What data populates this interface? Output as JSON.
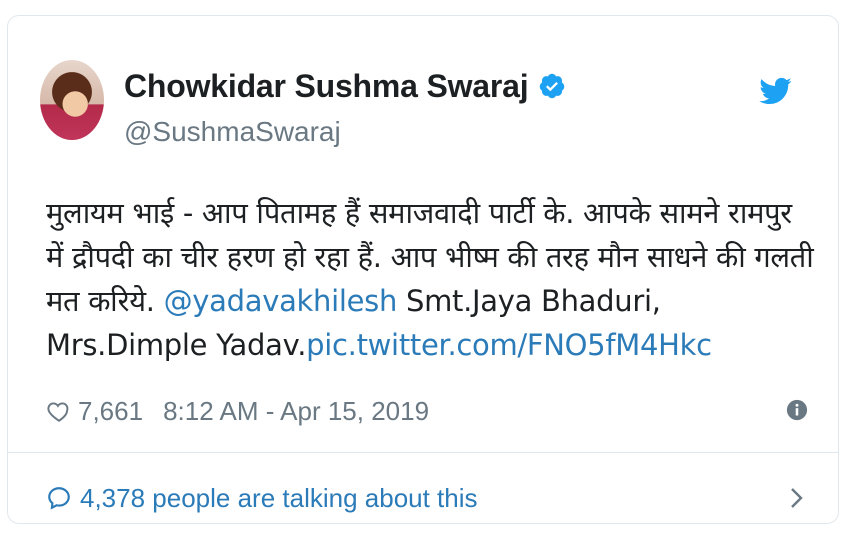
{
  "tweet": {
    "display_name": "Chowkidar Sushma Swaraj",
    "handle": "@SushmaSwaraj",
    "text_part1": "मुलायम भाई - आप पितामह हैं समाजवादी पार्टी के. आपके सामने रामपुर में द्रौपदी का चीर हरण हो रहा हैं. आप भीष्म की तरह मौन साधने की गलती मत करिये. ",
    "mention": "@yadavakhilesh",
    "text_part2": " Smt.Jaya Bhaduri, Mrs.Dimple Yadav.",
    "pic_link": "pic.twitter.com/FNO5fM4Hkc",
    "likes": "7,661",
    "timestamp": "8:12 AM - Apr 15, 2019"
  },
  "footer": {
    "talking": "4,378 people are talking about this"
  },
  "colors": {
    "link": "#2b7bb9",
    "verified": "#1da1f2",
    "twitter_brand": "#1da1f2",
    "muted": "#697882",
    "border": "#e1e8ed"
  },
  "icons": {
    "verified": "verified-badge-icon",
    "twitter": "twitter-bird-icon",
    "heart": "heart-icon",
    "info": "info-icon",
    "speech": "speech-bubble-icon",
    "chevron": "chevron-right-icon"
  }
}
